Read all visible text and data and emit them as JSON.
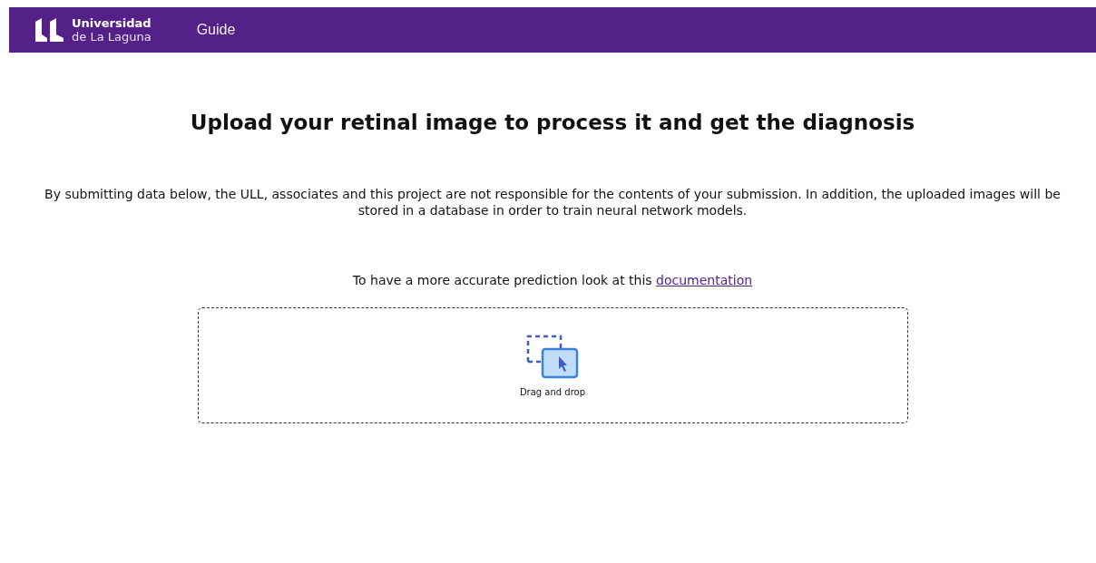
{
  "header": {
    "logo_line_1": "Universidad",
    "logo_line_2": "de La Laguna",
    "nav": [
      {
        "label": "Guide"
      }
    ]
  },
  "title": "Upload your retinal image to process it and get the diagnosis",
  "disclaimer": "By submitting data below, the ULL, associates and this project are not responsible for the contents of your submission. In addition, the uploaded images will be stored in a database in order to train neural network models.",
  "hint": {
    "text": "To have a more accurate prediction look at this ",
    "link": "documentation"
  },
  "dropzone": {
    "label": "Drag and drop"
  }
}
